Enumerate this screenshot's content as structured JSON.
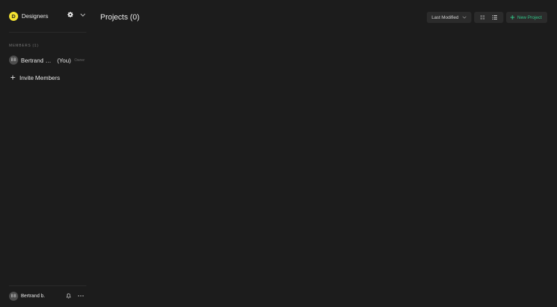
{
  "team": {
    "initial": "D",
    "name": "Designers",
    "avatar_color": "#f5e431"
  },
  "members": {
    "section_label": "MEMBERS (1)",
    "items": [
      {
        "initials": "BB",
        "name": "Bertrand br...",
        "you_label": "(You)",
        "role": "Owner"
      }
    ],
    "invite_label": "Invite Members"
  },
  "current_user": {
    "initials": "BB",
    "name": "Bertrand b."
  },
  "main": {
    "title": "Projects (0)",
    "sort_label": "Last Modified",
    "new_project_label": "New Project"
  },
  "colors": {
    "background": "#1c1c1c",
    "accent": "#31c98a",
    "control_bg": "#2b2b2b"
  },
  "icons": [
    "gear-icon",
    "chevron-down-icon",
    "plus-icon",
    "bell-icon",
    "more-dots-icon",
    "grid-view-icon",
    "list-view-icon"
  ]
}
